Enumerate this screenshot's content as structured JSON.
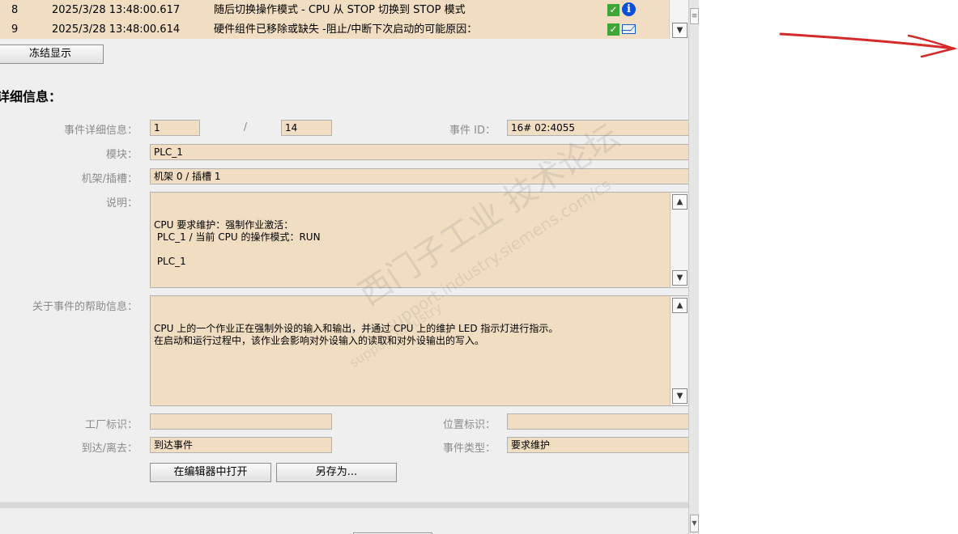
{
  "events": [
    {
      "num": "8",
      "time": "2025/3/28 13:48:00.617",
      "desc": "随后切换操作模式 - CPU 从 STOP 切换到 STOP 模式",
      "icon": "info-icon"
    },
    {
      "num": "9",
      "time": "2025/3/28 13:48:00.614",
      "desc": "硬件组件已移除或缺失   -阻止/中断下次启动的可能原因：",
      "icon": "mail-icon"
    }
  ],
  "freeze_button": "冻结显示",
  "details": {
    "section_title": "详细信息：",
    "event_detail_label": "事件详细信息：",
    "event_detail_index": "1",
    "event_detail_sep": "/",
    "event_detail_total": "14",
    "event_id_label": "事件 ID：",
    "event_id_value": "16# 02:4055",
    "module_label": "模块：",
    "module_value": "PLC_1",
    "rack_slot_label": "机架/插槽：",
    "rack_slot_value": "机架 0 / 插槽 1",
    "description_label": "说明：",
    "description_value": "CPU 要求维护：强制作业激活：\n PLC_1 / 当前 CPU 的操作模式：RUN\n\n PLC_1",
    "help_label": "关于事件的帮助信息：",
    "help_value": "CPU 上的一个作业正在强制外设的输入和输出，并通过 CPU 上的维护 LED 指示灯进行指示。\n在启动和运行过程中，该作业会影响对外设输入的读取和对外设输出的写入。",
    "plant_id_label": "工厂标识：",
    "plant_id_value": "",
    "location_id_label": "位置标识：",
    "location_id_value": "",
    "arrive_leave_label": "到达/离去：",
    "arrive_leave_value": "到达事件",
    "event_type_label": "事件类型：",
    "event_type_value": "要求维护",
    "open_in_editor_button": "在编辑器中打开",
    "save_as_button": "另存为..."
  },
  "watermark": {
    "line1": "西门子工业 技术论坛",
    "line2": "support.industry.siemens.com/cs",
    "line3": "support.industry"
  },
  "colors": {
    "field_bg": "#f0ddc2",
    "panel_bg": "#efefef",
    "ok_green": "#3fa535",
    "info_blue": "#0a4fd8",
    "annotation_red": "#d42a2a"
  }
}
